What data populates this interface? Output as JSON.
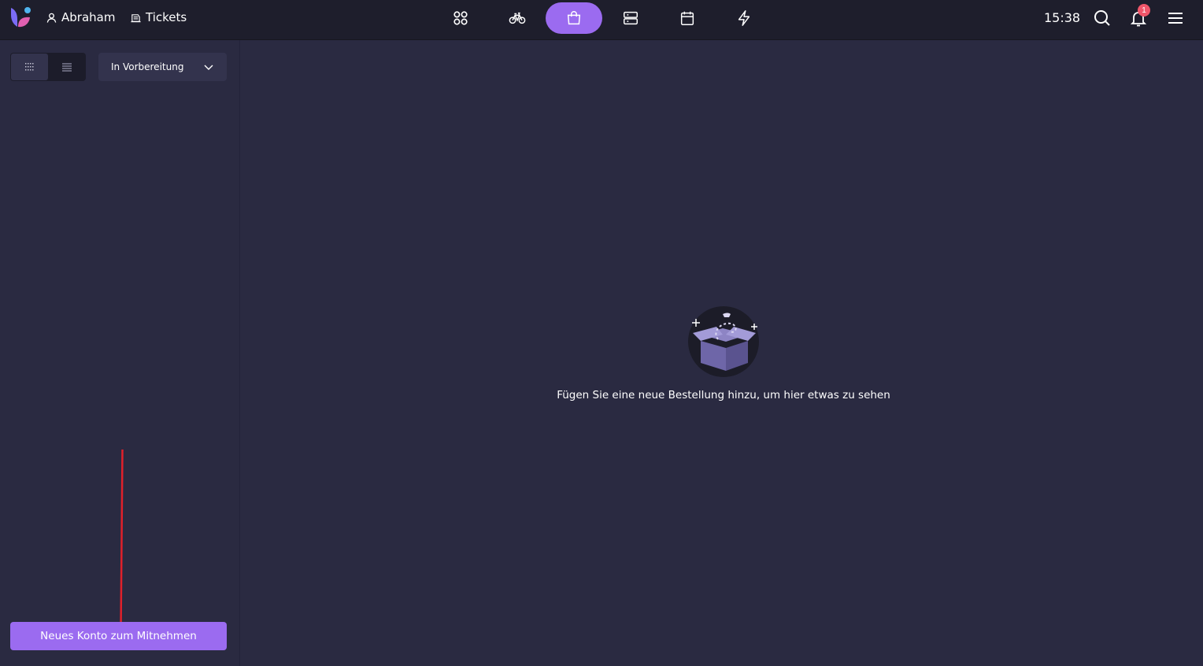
{
  "header": {
    "user_name": "Abraham",
    "tickets_label": "Tickets",
    "time": "15:38",
    "notification_count": "1",
    "accent_color": "#9b6bf0",
    "nav": [
      {
        "icon": "grid-circles-icon",
        "active": false
      },
      {
        "icon": "bicycle-icon",
        "active": false
      },
      {
        "icon": "shopping-bag-icon",
        "active": true
      },
      {
        "icon": "server-icon",
        "active": false
      },
      {
        "icon": "calendar-icon",
        "active": false
      },
      {
        "icon": "lightning-icon",
        "active": false
      }
    ]
  },
  "sidebar": {
    "view_modes": [
      {
        "icon": "grid-view-icon",
        "active": true
      },
      {
        "icon": "list-view-icon",
        "active": false
      }
    ],
    "status_filter": {
      "selected": "In Vorbereitung"
    },
    "new_button_label": "Neues Konto zum Mitnehmen"
  },
  "main": {
    "empty_message": "Fügen Sie eine neue Bestellung hinzu, um hier etwas zu sehen"
  }
}
